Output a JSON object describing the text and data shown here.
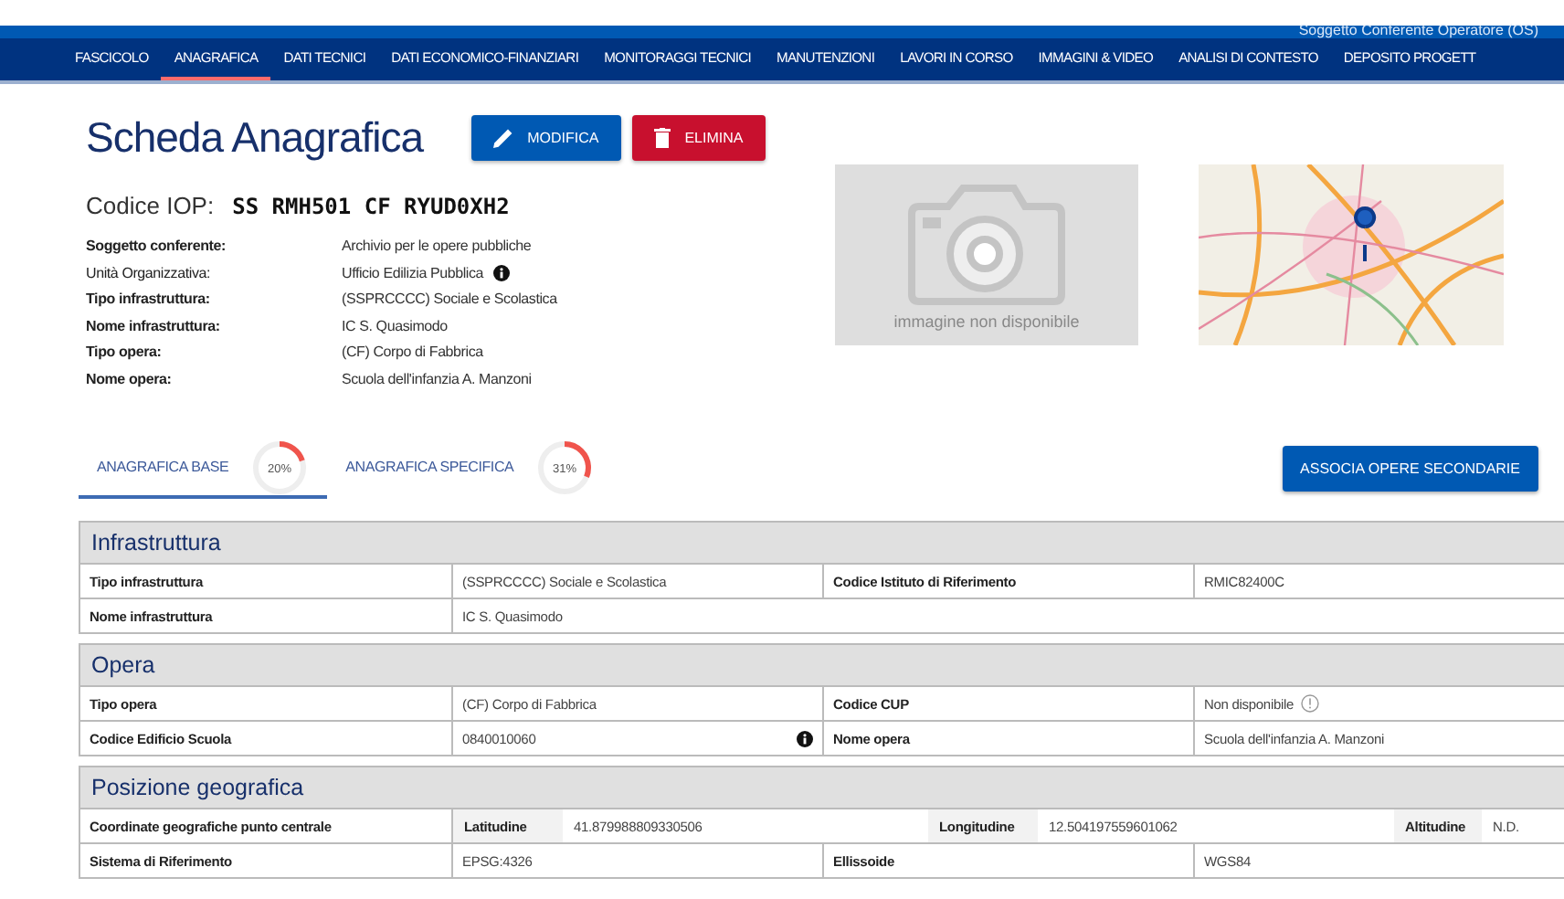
{
  "top_bar": {
    "user": "Soggetto Conferente Operatore (OS)"
  },
  "nav": [
    {
      "label": "FASCICOLO",
      "selected": false
    },
    {
      "label": "ANAGRAFICA",
      "selected": true
    },
    {
      "label": "DATI TECNICI",
      "selected": false
    },
    {
      "label": "DATI ECONOMICO-FINANZIARI",
      "selected": false
    },
    {
      "label": "MONITORAGGI TECNICI",
      "selected": false
    },
    {
      "label": "MANUTENZIONI",
      "selected": false
    },
    {
      "label": "LAVORI IN CORSO",
      "selected": false
    },
    {
      "label": "IMMAGINI & VIDEO",
      "selected": false
    },
    {
      "label": "ANALISI DI CONTESTO",
      "selected": false
    },
    {
      "label": "DEPOSITO PROGETT",
      "selected": false
    }
  ],
  "header": {
    "title": "Scheda Anagrafica",
    "buttons": [
      {
        "kind": "edit",
        "label": "MODIFICA"
      },
      {
        "kind": "delete",
        "label": "ELIMINA"
      }
    ]
  },
  "code": {
    "label": "Codice IOP:",
    "value": "SS RMH501 CF RYUD0XH2"
  },
  "details": [
    {
      "label": "Soggetto conferente:",
      "value": "Archivio per le opere pubbliche",
      "bold": true,
      "info": false
    },
    {
      "label": "Unità Organizzativa:",
      "value": "Ufficio Edilizia Pubblica",
      "bold": false,
      "info": true
    },
    {
      "label": "Tipo infrastruttura:",
      "value": "(SSPRCCCC) Sociale e Scolastica",
      "bold": true,
      "info": false
    },
    {
      "label": "Nome infrastruttura:",
      "value": "IC S. Quasimodo",
      "bold": true,
      "info": false
    },
    {
      "label": "Tipo opera:",
      "value": "(CF) Corpo di Fabbrica",
      "bold": true,
      "info": false
    },
    {
      "label": "Nome opera:",
      "value": "Scuola dell'infanzia A. Manzoni",
      "bold": true,
      "info": false
    }
  ],
  "photo": {
    "caption": "immagine non disponibile"
  },
  "tabs": [
    {
      "label": "ANAGRAFICA BASE",
      "progress": "20%",
      "level": 0.2,
      "selected": true
    },
    {
      "label": "ANAGRAFICA SPECIFICA",
      "progress": "31%",
      "level": 0.31,
      "selected": false
    }
  ],
  "action_button": "ASSOCIA OPERE SECONDARIE",
  "sections": [
    {
      "title": "Infrastruttura",
      "rows": [
        {
          "kind": "pairs",
          "cells": [
            {
              "kind": "label",
              "text": "Tipo infrastruttura"
            },
            {
              "kind": "value",
              "text": "(SSPRCCCC) Sociale e Scolastica"
            },
            {
              "kind": "label",
              "text": "Codice Istituto di Riferimento"
            },
            {
              "kind": "value",
              "text": "RMIC82400C"
            }
          ]
        },
        {
          "kind": "pairs",
          "cells": [
            {
              "kind": "label",
              "text": "Nome infrastruttura"
            },
            {
              "kind": "value",
              "text": "IC S. Quasimodo"
            }
          ]
        }
      ]
    },
    {
      "title": "Opera",
      "rows": [
        {
          "kind": "pairs",
          "cells": [
            {
              "kind": "label",
              "text": "Tipo opera"
            },
            {
              "kind": "value",
              "text": "(CF) Corpo di Fabbrica"
            },
            {
              "kind": "label",
              "text": "Codice CUP"
            },
            {
              "kind": "warnvalue",
              "text": "Non disponibile"
            }
          ]
        },
        {
          "kind": "pairs",
          "cells": [
            {
              "kind": "label",
              "text": "Codice Edificio Scuola"
            },
            {
              "kind": "infovalue",
              "text": "0840010060"
            },
            {
              "kind": "label",
              "text": "Nome opera"
            },
            {
              "kind": "value",
              "text": "Scuola dell'infanzia A. Manzoni"
            }
          ]
        }
      ]
    },
    {
      "title": "Posizione geografica",
      "rows": [
        {
          "kind": "coords",
          "cells": [
            {
              "kind": "label",
              "text": "Coordinate geografiche punto centrale"
            },
            {
              "kind": "sublabel",
              "text": "Latitudine"
            },
            {
              "kind": "value",
              "text": "41.879988809330506"
            },
            {
              "kind": "sublabel",
              "text": "Longitudine"
            },
            {
              "kind": "value",
              "text": "12.504197559601062"
            },
            {
              "kind": "sublabel",
              "text": "Altitudine"
            },
            {
              "kind": "value",
              "text": "N.D."
            }
          ]
        },
        {
          "kind": "pairs",
          "cells": [
            {
              "kind": "label",
              "text": "Sistema di Riferimento"
            },
            {
              "kind": "value",
              "text": "EPSG:4326"
            },
            {
              "kind": "label",
              "text": "Ellissoide"
            },
            {
              "kind": "value",
              "text": "WGS84"
            }
          ]
        }
      ]
    }
  ]
}
